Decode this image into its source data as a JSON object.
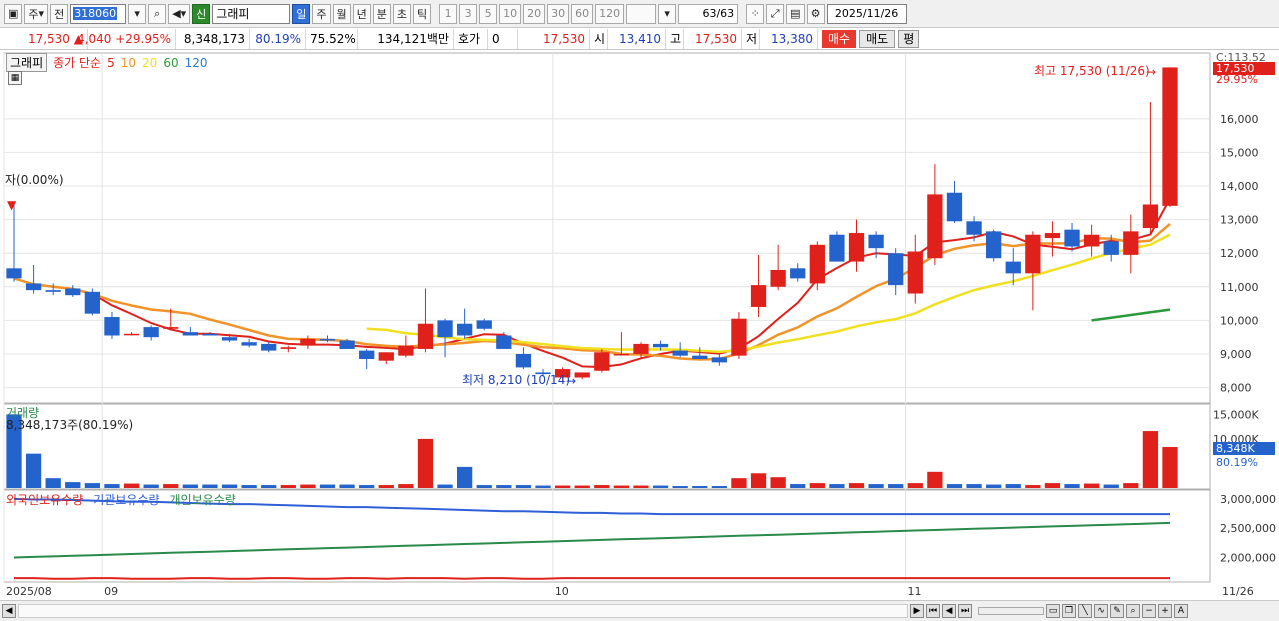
{
  "toolbar": {
    "period_type": "주",
    "prev_label": "전",
    "stock_code": "318060",
    "stock_badge": "신",
    "stock_name": "그래피",
    "period_tabs": [
      "일",
      "주",
      "월",
      "년",
      "분",
      "초",
      "틱"
    ],
    "interval_tabs": [
      "1",
      "3",
      "5",
      "10",
      "20",
      "30",
      "60",
      "120"
    ],
    "page_value": "63/63",
    "date": "2025/11/26",
    "icons": [
      "chart-layout-icon",
      "search-icon",
      "speaker-icon",
      "zoom-icon",
      "settings-icon",
      "save-icon",
      "gear-icon"
    ]
  },
  "info": {
    "price": "17,530",
    "change": "4,040",
    "change_pct": "+29.95%",
    "volume": "8,348,173",
    "volume_ratio": "80.19%",
    "turnover": "75.52%",
    "amount": "134,121백만",
    "hoga_label": "호가",
    "hoga_value": "0",
    "ask": "17,530",
    "open_label": "시",
    "open": "13,410",
    "high_label": "고",
    "high": "17,530",
    "low_label": "저",
    "low": "13,380",
    "buy_label": "매수",
    "sell_label": "매도",
    "avg_label": "평"
  },
  "price_pane": {
    "label": "그래피",
    "legend_prefix": "종가 단순",
    "ma": [
      {
        "period": "5",
        "color": "#e0201b"
      },
      {
        "period": "10",
        "color": "#f2932a"
      },
      {
        "period": "20",
        "color": "#f0e020"
      },
      {
        "period": "60",
        "color": "#2a9a3a"
      },
      {
        "period": "120",
        "color": "#2a7ad6"
      }
    ],
    "yticks": [
      "8,000",
      "9,000",
      "10,000",
      "11,000",
      "12,000",
      "13,000",
      "14,000",
      "15,000",
      "16,000"
    ],
    "top_partial_label": "C:113.52",
    "current_tag": "17,530",
    "current_pct": "29.95%",
    "high_annotation": "최고 17,530 (11/26)",
    "low_annotation": "최저 8,210 (10/14)",
    "left_annotation": "자(0.00%)",
    "colors": {
      "up": "#e0201b",
      "down": "#2563cc"
    }
  },
  "volume_pane": {
    "label": "거래량",
    "sub_label": "8,348,173주(80.19%)",
    "yticks": [
      "10,000K",
      "15,000K"
    ],
    "current_tag": "8,348K",
    "current_pct": "80.19%"
  },
  "holding_pane": {
    "labels": [
      "외국인보유수량",
      "기관보유수량",
      "개인보유수량"
    ],
    "colors": [
      "#e0201b",
      "#2f5fd6",
      "#2a8a4a"
    ],
    "yticks": [
      "2,000,000",
      "2,500,000",
      "3,000,000"
    ]
  },
  "x_axis": {
    "labels": [
      "2025/08",
      "09",
      "10",
      "11"
    ],
    "right_label": "11/26"
  },
  "chart_data": {
    "type": "candlestick",
    "candles": [
      [
        11550,
        13450,
        11150,
        11250
      ],
      [
        11100,
        11650,
        10800,
        10900
      ],
      [
        10900,
        11100,
        10750,
        10850
      ],
      [
        10950,
        11050,
        10700,
        10750
      ],
      [
        10850,
        10950,
        10150,
        10200
      ],
      [
        10100,
        10250,
        9450,
        9550
      ],
      [
        9600,
        9650,
        9550,
        9600
      ],
      [
        9800,
        9850,
        9400,
        9500
      ],
      [
        9750,
        10350,
        9700,
        9800
      ],
      [
        9650,
        9800,
        9550,
        9550
      ],
      [
        9600,
        9650,
        9550,
        9550
      ],
      [
        9500,
        9600,
        9350,
        9400
      ],
      [
        9350,
        9450,
        9200,
        9250
      ],
      [
        9300,
        9350,
        9050,
        9100
      ],
      [
        9150,
        9250,
        9050,
        9200
      ],
      [
        9250,
        9550,
        9150,
        9450
      ],
      [
        9450,
        9550,
        9350,
        9400
      ],
      [
        9400,
        9450,
        9150,
        9150
      ],
      [
        9100,
        9150,
        8550,
        8850
      ],
      [
        8800,
        9050,
        8700,
        9050
      ],
      [
        8950,
        9550,
        8900,
        9250
      ],
      [
        9150,
        10950,
        9050,
        9900
      ],
      [
        10000,
        10050,
        8900,
        9500
      ],
      [
        9900,
        10350,
        9450,
        9550
      ],
      [
        10000,
        10050,
        9700,
        9750
      ],
      [
        9550,
        9650,
        9150,
        9150
      ],
      [
        9000,
        9200,
        8550,
        8600
      ],
      [
        8450,
        8550,
        8350,
        8400
      ],
      [
        8300,
        8600,
        8210,
        8550
      ],
      [
        8300,
        8400,
        8250,
        8450
      ],
      [
        8500,
        9150,
        8450,
        9050
      ],
      [
        9000,
        9650,
        8950,
        9000
      ],
      [
        9000,
        9350,
        8850,
        9300
      ],
      [
        9300,
        9400,
        9100,
        9200
      ],
      [
        9100,
        9350,
        8900,
        8950
      ],
      [
        8950,
        9200,
        8850,
        8850
      ],
      [
        8900,
        9000,
        8650,
        8750
      ],
      [
        8950,
        10250,
        8850,
        10050
      ],
      [
        10400,
        11950,
        10100,
        11050
      ],
      [
        11000,
        12250,
        10900,
        11500
      ],
      [
        11550,
        11700,
        11150,
        11250
      ],
      [
        11100,
        12350,
        10900,
        12250
      ],
      [
        12550,
        12650,
        11800,
        11750
      ],
      [
        11750,
        13000,
        11450,
        12600
      ],
      [
        12550,
        12650,
        11850,
        12150
      ],
      [
        12000,
        12150,
        10750,
        11050
      ],
      [
        10800,
        12550,
        10500,
        12050
      ],
      [
        11850,
        14650,
        11650,
        13750
      ],
      [
        13800,
        14150,
        12900,
        12950
      ],
      [
        12950,
        13100,
        12350,
        12550
      ],
      [
        12650,
        12700,
        11750,
        11850
      ],
      [
        11750,
        12150,
        11050,
        11400
      ],
      [
        11400,
        12650,
        10300,
        12550
      ],
      [
        12450,
        12950,
        11900,
        12600
      ],
      [
        12700,
        12900,
        12050,
        12200
      ],
      [
        12200,
        12850,
        11900,
        12550
      ],
      [
        12350,
        12550,
        11750,
        11950
      ],
      [
        11950,
        13150,
        11400,
        12650
      ],
      [
        12750,
        16500,
        12600,
        13450
      ],
      [
        13410,
        17530,
        13380,
        17530
      ]
    ],
    "volume_k": [
      15000,
      7000,
      2000,
      1200,
      1000,
      800,
      900,
      700,
      800,
      700,
      700,
      700,
      600,
      600,
      600,
      700,
      700,
      700,
      600,
      600,
      800,
      10000,
      700,
      4300,
      600,
      600,
      600,
      500,
      500,
      500,
      600,
      500,
      500,
      500,
      400,
      400,
      400,
      2000,
      3000,
      2200,
      800,
      1000,
      800,
      1000,
      800,
      800,
      1000,
      3300,
      800,
      800,
      700,
      800,
      600,
      1000,
      800,
      900,
      700,
      1000,
      11600,
      8348
    ],
    "volume_ylim": [
      0,
      16500
    ],
    "price_ylim": [
      7600,
      17900
    ],
    "holdings": {
      "foreign": [
        1650000,
        1650000,
        1640000,
        1640000,
        1650000,
        1650000,
        1640000,
        1640000,
        1640000,
        1650000,
        1650000,
        1640000,
        1640000,
        1650000,
        1650000,
        1640000,
        1640000,
        1650000,
        1650000,
        1640000,
        1650000,
        1650000,
        1650000,
        1640000,
        1650000,
        1650000,
        1640000,
        1640000,
        1650000,
        1650000,
        1650000,
        1650000,
        1650000,
        1650000,
        1650000,
        1650000,
        1650000,
        1650000,
        1650000,
        1650000,
        1650000,
        1650000,
        1650000,
        1650000,
        1650000,
        1650000,
        1650000,
        1650000,
        1650000,
        1650000,
        1650000,
        1650000,
        1650000,
        1650000,
        1650000,
        1650000,
        1650000,
        1650000,
        1650000,
        1650000
      ],
      "institution": [
        3000000,
        2990000,
        2990000,
        2980000,
        2970000,
        2960000,
        2950000,
        2950000,
        2940000,
        2930000,
        2920000,
        2910000,
        2910000,
        2900000,
        2890000,
        2880000,
        2870000,
        2860000,
        2860000,
        2850000,
        2840000,
        2830000,
        2820000,
        2810000,
        2800000,
        2790000,
        2790000,
        2780000,
        2770000,
        2760000,
        2760000,
        2750000,
        2750000,
        2740000,
        2740000,
        2740000,
        2740000,
        2740000,
        2740000,
        2740000,
        2740000,
        2740000,
        2740000,
        2740000,
        2740000,
        2740000,
        2740000,
        2740000,
        2740000,
        2740000,
        2740000,
        2740000,
        2740000,
        2740000,
        2740000,
        2740000,
        2740000,
        2740000,
        2740000,
        2740000
      ],
      "individual": [
        2000000,
        2010000,
        2020000,
        2030000,
        2040000,
        2050000,
        2060000,
        2070000,
        2080000,
        2090000,
        2100000,
        2110000,
        2120000,
        2130000,
        2140000,
        2150000,
        2160000,
        2170000,
        2180000,
        2190000,
        2200000,
        2210000,
        2220000,
        2230000,
        2240000,
        2250000,
        2260000,
        2270000,
        2280000,
        2290000,
        2300000,
        2310000,
        2320000,
        2330000,
        2340000,
        2350000,
        2360000,
        2370000,
        2380000,
        2390000,
        2400000,
        2410000,
        2420000,
        2430000,
        2440000,
        2450000,
        2460000,
        2470000,
        2480000,
        2490000,
        2500000,
        2510000,
        2520000,
        2530000,
        2540000,
        2550000,
        2560000,
        2570000,
        2580000,
        2590000
      ]
    }
  }
}
